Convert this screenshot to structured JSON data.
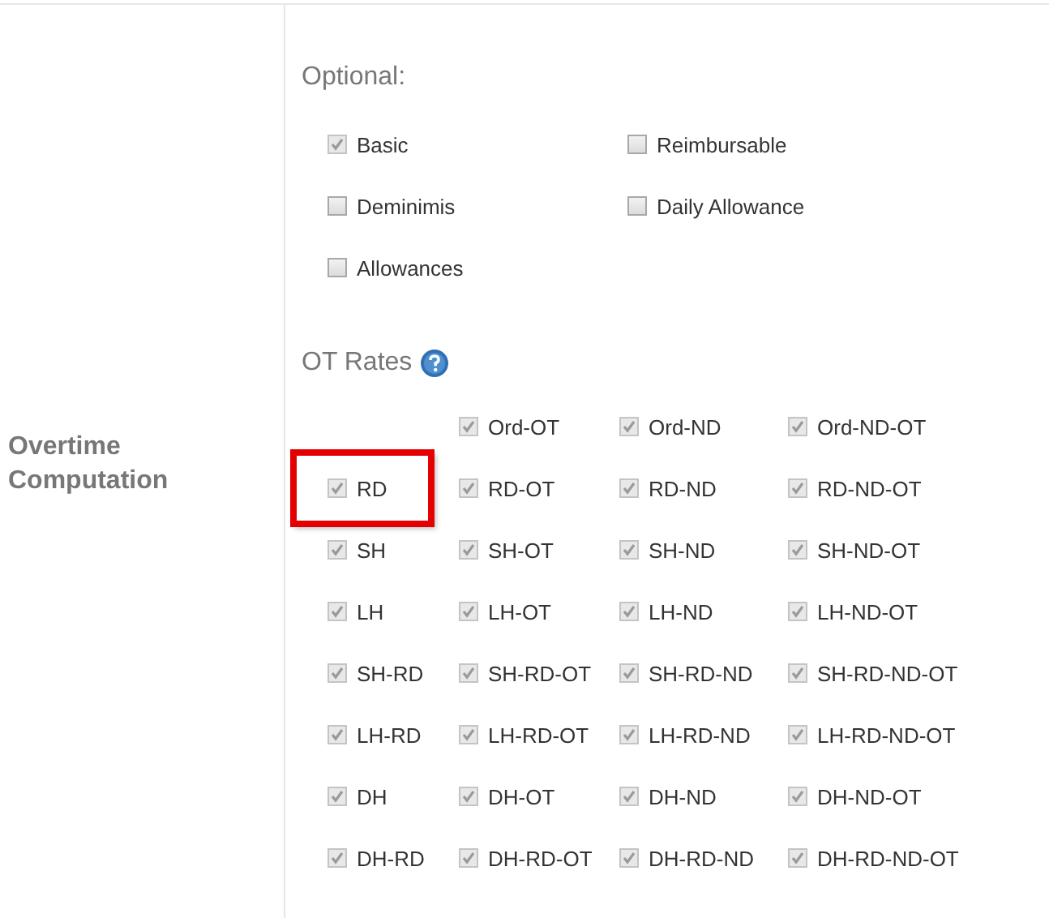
{
  "section_label": "Overtime Computation",
  "optional": {
    "title": "Optional:",
    "items": [
      {
        "label": "Basic",
        "checked": true,
        "disabled": true
      },
      {
        "label": "Reimbursable",
        "checked": false,
        "disabled": false
      },
      {
        "label": "Deminimis",
        "checked": false,
        "disabled": false
      },
      {
        "label": "Daily Allowance",
        "checked": false,
        "disabled": false
      },
      {
        "label": "Allowances",
        "checked": false,
        "disabled": false
      }
    ]
  },
  "ot_rates": {
    "title": "OT Rates",
    "rows": [
      [
        "",
        {
          "label": "Ord-OT",
          "checked": true,
          "disabled": true,
          "highlighted": false
        },
        {
          "label": "Ord-ND",
          "checked": true,
          "disabled": true,
          "highlighted": false
        },
        {
          "label": "Ord-ND-OT",
          "checked": true,
          "disabled": true,
          "highlighted": false
        }
      ],
      [
        {
          "label": "RD",
          "checked": true,
          "disabled": true,
          "highlighted": true
        },
        {
          "label": "RD-OT",
          "checked": true,
          "disabled": true,
          "highlighted": false
        },
        {
          "label": "RD-ND",
          "checked": true,
          "disabled": true,
          "highlighted": false
        },
        {
          "label": "RD-ND-OT",
          "checked": true,
          "disabled": true,
          "highlighted": false
        }
      ],
      [
        {
          "label": "SH",
          "checked": true,
          "disabled": true,
          "highlighted": false
        },
        {
          "label": "SH-OT",
          "checked": true,
          "disabled": true,
          "highlighted": false
        },
        {
          "label": "SH-ND",
          "checked": true,
          "disabled": true,
          "highlighted": false
        },
        {
          "label": "SH-ND-OT",
          "checked": true,
          "disabled": true,
          "highlighted": false
        }
      ],
      [
        {
          "label": "LH",
          "checked": true,
          "disabled": true,
          "highlighted": false
        },
        {
          "label": "LH-OT",
          "checked": true,
          "disabled": true,
          "highlighted": false
        },
        {
          "label": "LH-ND",
          "checked": true,
          "disabled": true,
          "highlighted": false
        },
        {
          "label": "LH-ND-OT",
          "checked": true,
          "disabled": true,
          "highlighted": false
        }
      ],
      [
        {
          "label": "SH-RD",
          "checked": true,
          "disabled": true,
          "highlighted": false
        },
        {
          "label": "SH-RD-OT",
          "checked": true,
          "disabled": true,
          "highlighted": false
        },
        {
          "label": "SH-RD-ND",
          "checked": true,
          "disabled": true,
          "highlighted": false
        },
        {
          "label": "SH-RD-ND-OT",
          "checked": true,
          "disabled": true,
          "highlighted": false
        }
      ],
      [
        {
          "label": "LH-RD",
          "checked": true,
          "disabled": true,
          "highlighted": false
        },
        {
          "label": "LH-RD-OT",
          "checked": true,
          "disabled": true,
          "highlighted": false
        },
        {
          "label": "LH-RD-ND",
          "checked": true,
          "disabled": true,
          "highlighted": false
        },
        {
          "label": "LH-RD-ND-OT",
          "checked": true,
          "disabled": true,
          "highlighted": false
        }
      ],
      [
        {
          "label": "DH",
          "checked": true,
          "disabled": true,
          "highlighted": false
        },
        {
          "label": "DH-OT",
          "checked": true,
          "disabled": true,
          "highlighted": false
        },
        {
          "label": "DH-ND",
          "checked": true,
          "disabled": true,
          "highlighted": false
        },
        {
          "label": "DH-ND-OT",
          "checked": true,
          "disabled": true,
          "highlighted": false
        }
      ],
      [
        {
          "label": "DH-RD",
          "checked": true,
          "disabled": true,
          "highlighted": false
        },
        {
          "label": "DH-RD-OT",
          "checked": true,
          "disabled": true,
          "highlighted": false
        },
        {
          "label": "DH-RD-ND",
          "checked": true,
          "disabled": true,
          "highlighted": false
        },
        {
          "label": "DH-RD-ND-OT",
          "checked": true,
          "disabled": true,
          "highlighted": false
        }
      ]
    ]
  }
}
